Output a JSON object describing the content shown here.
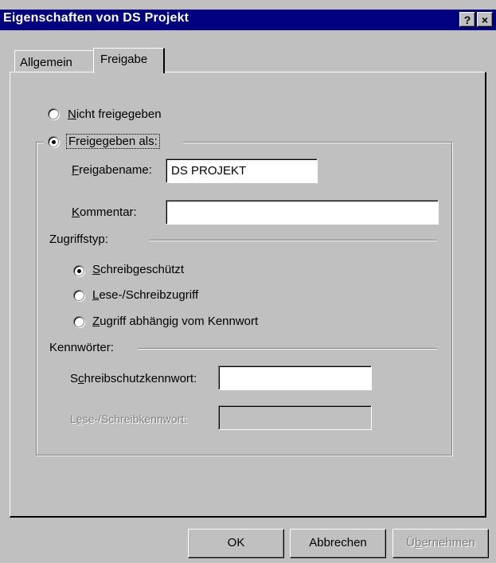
{
  "window": {
    "title": "Eigenschaften von DS Projekt",
    "help_label": "?",
    "close_label": "×"
  },
  "tabs": [
    {
      "label": "Allgemein"
    },
    {
      "label": "Freigabe"
    }
  ],
  "sharing": {
    "not_shared": {
      "accesskey": "N",
      "rest": "icht freigegeben",
      "selected": false
    },
    "shared_as": {
      "label": "Freigegeben als:",
      "selected": true
    },
    "share_name_label": {
      "accesskey": "F",
      "rest": "reigabename:"
    },
    "share_name_value": "DS PROJEKT",
    "comment_label": {
      "accesskey": "K",
      "rest": "ommentar:"
    },
    "comment_value": "",
    "access_type_heading": "Zugriffstyp:",
    "access_options": [
      {
        "accesskey": "S",
        "rest": "chreibgeschützt",
        "selected": true
      },
      {
        "accesskey": "L",
        "rest": "ese-/Schreibzugriff",
        "selected": false
      },
      {
        "accesskey": "Z",
        "rest": "ugriff abhängig vom Kennwort",
        "selected": false
      }
    ],
    "passwords_heading": "Kennwörter:",
    "readonly_pw_label": {
      "pre": "S",
      "accesskey": "c",
      "rest": "hreibschutzkennwort:"
    },
    "readwrite_pw_label": {
      "pre": "L",
      "accesskey": "e",
      "rest": "se-/Schreibkennwort:"
    }
  },
  "buttons": {
    "ok": "OK",
    "cancel": "Abbrechen",
    "apply": {
      "pre": "Ü",
      "accesskey": "b",
      "rest": "ernehmen"
    }
  }
}
